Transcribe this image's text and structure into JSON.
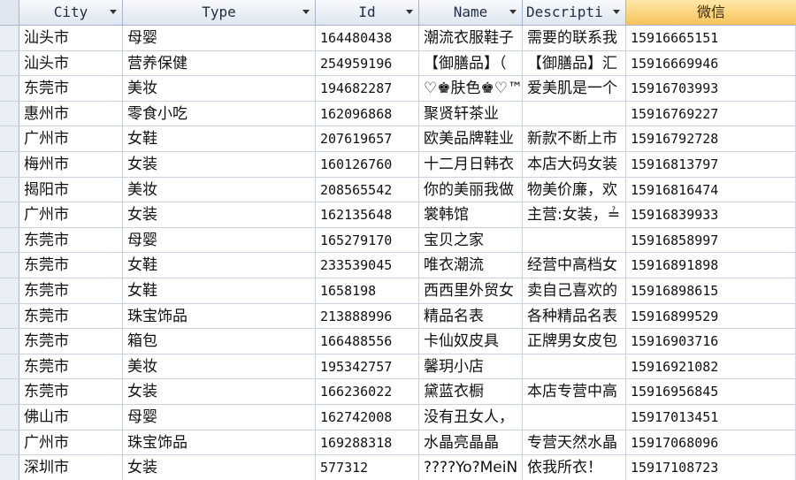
{
  "headers": {
    "city": "City",
    "type": "Type",
    "id": "Id",
    "name": "Name",
    "description": "Descripti",
    "wechat": "微信"
  },
  "rows": [
    {
      "city": "汕头市",
      "type": "母婴",
      "id": "164480438",
      "name": "潮流衣服鞋子",
      "description": "需要的联系我",
      "wechat": "15916665151"
    },
    {
      "city": "汕头市",
      "type": "营养保健",
      "id": "254959196",
      "name": "【御膳品】（",
      "description": "【御膳品】汇",
      "wechat": "15916669946"
    },
    {
      "city": "东莞市",
      "type": "美妆",
      "id": "194682287",
      "name": "♡♚肤色♚♡™",
      "description": "爱美肌是一个",
      "wechat": "15916703993"
    },
    {
      "city": "惠州市",
      "type": "零食小吃",
      "id": "162096868",
      "name": "聚贤轩茶业",
      "description": "",
      "wechat": "15916769227"
    },
    {
      "city": "广州市",
      "type": "女鞋",
      "id": "207619657",
      "name": "欧美品牌鞋业",
      "description": "新款不断上市",
      "wechat": "15916792728"
    },
    {
      "city": "梅州市",
      "type": "女装",
      "id": "160126760",
      "name": "十二月日韩衣",
      "description": "本店大码女装",
      "wechat": "15916813797"
    },
    {
      "city": "揭阳市",
      "type": "美妆",
      "id": "208565542",
      "name": "你的美丽我做",
      "description": "物美价廉，欢",
      "wechat": "15916816474"
    },
    {
      "city": "广州市",
      "type": "女装",
      "id": "162135648",
      "name": "裳韩馆",
      "description": "主营:女装，≟",
      "wechat": "15916839933"
    },
    {
      "city": "东莞市",
      "type": "母婴",
      "id": "165279170",
      "name": "宝贝之家",
      "description": "",
      "wechat": "15916858997"
    },
    {
      "city": "东莞市",
      "type": "女鞋",
      "id": "233539045",
      "name": "唯衣潮流",
      "description": "经营中高档女",
      "wechat": "15916891898"
    },
    {
      "city": "东莞市",
      "type": "女鞋",
      "id": "1658198",
      "name": "西西里外贸女",
      "description": "卖自己喜欢的",
      "wechat": "15916898615"
    },
    {
      "city": "东莞市",
      "type": "珠宝饰品",
      "id": "213888996",
      "name": "精品名表",
      "description": "各种精品名表",
      "wechat": "15916899529"
    },
    {
      "city": "东莞市",
      "type": "箱包",
      "id": "166488556",
      "name": "卡仙奴皮具",
      "description": "正牌男女皮包",
      "wechat": "15916903716"
    },
    {
      "city": "东莞市",
      "type": "美妆",
      "id": "195342757",
      "name": "馨玥小店",
      "description": "",
      "wechat": "15916921082"
    },
    {
      "city": "东莞市",
      "type": "女装",
      "id": "166236022",
      "name": "黛蓝衣橱",
      "description": "本店专营中高",
      "wechat": "15916956845"
    },
    {
      "city": "佛山市",
      "type": "母婴",
      "id": "162742008",
      "name": "没有丑女人，",
      "description": "",
      "wechat": "15917013451"
    },
    {
      "city": "广州市",
      "type": "珠宝饰品",
      "id": "169288318",
      "name": "水晶亮晶晶",
      "description": "专营天然水晶",
      "wechat": "15917068096"
    },
    {
      "city": "深圳市",
      "type": "女装",
      "id": "577312",
      "name": "????Yo?MeiN",
      "description": "依我所衣！",
      "wechat": "15917108723"
    }
  ]
}
